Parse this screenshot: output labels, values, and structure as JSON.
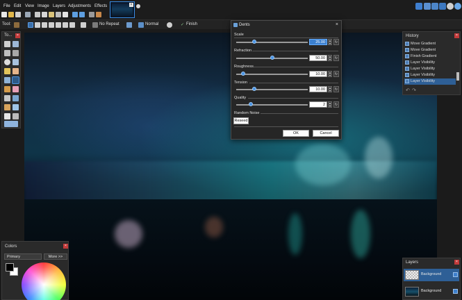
{
  "menu": [
    "File",
    "Edit",
    "View",
    "Image",
    "Layers",
    "Adjustments",
    "Effects"
  ],
  "toolbar": {
    "tool_label": "Tool:",
    "repeat": "No Repeat",
    "blend": "Normal",
    "finish": "Finish"
  },
  "tools_panel": {
    "title": "To...",
    "close": "×"
  },
  "history": {
    "title": "History",
    "close": "×",
    "items": [
      "Move Gradient",
      "Move Gradient",
      "Finish Gradient",
      "Layer Visibility",
      "Layer Visibility",
      "Layer Visibility",
      "Layer Visibility"
    ],
    "selected_index": 6
  },
  "colors": {
    "title": "Colors",
    "close": "×",
    "mode": "Primary",
    "more": "More >>",
    "primary": "#000000",
    "secondary": "#ffffff"
  },
  "layers": {
    "title": "Layers",
    "close": "×",
    "items": [
      "Background",
      "Background"
    ]
  },
  "dialog": {
    "title": "Dents",
    "close": "×",
    "props": [
      {
        "label": "Scale",
        "value": "25.00",
        "fraction": 0.25
      },
      {
        "label": "Refraction",
        "value": "50.00",
        "fraction": 0.5
      },
      {
        "label": "Roughness",
        "value": "10.00",
        "fraction": 0.1
      },
      {
        "label": "Tension",
        "value": "10.00",
        "fraction": 0.25
      },
      {
        "label": "Quality",
        "value": "2",
        "fraction": 0.2
      }
    ],
    "random_noise_label": "Random Noise",
    "reseed": "Reseed",
    "ok": "OK",
    "cancel": "Cancel"
  },
  "accent": "#3a8ee6"
}
